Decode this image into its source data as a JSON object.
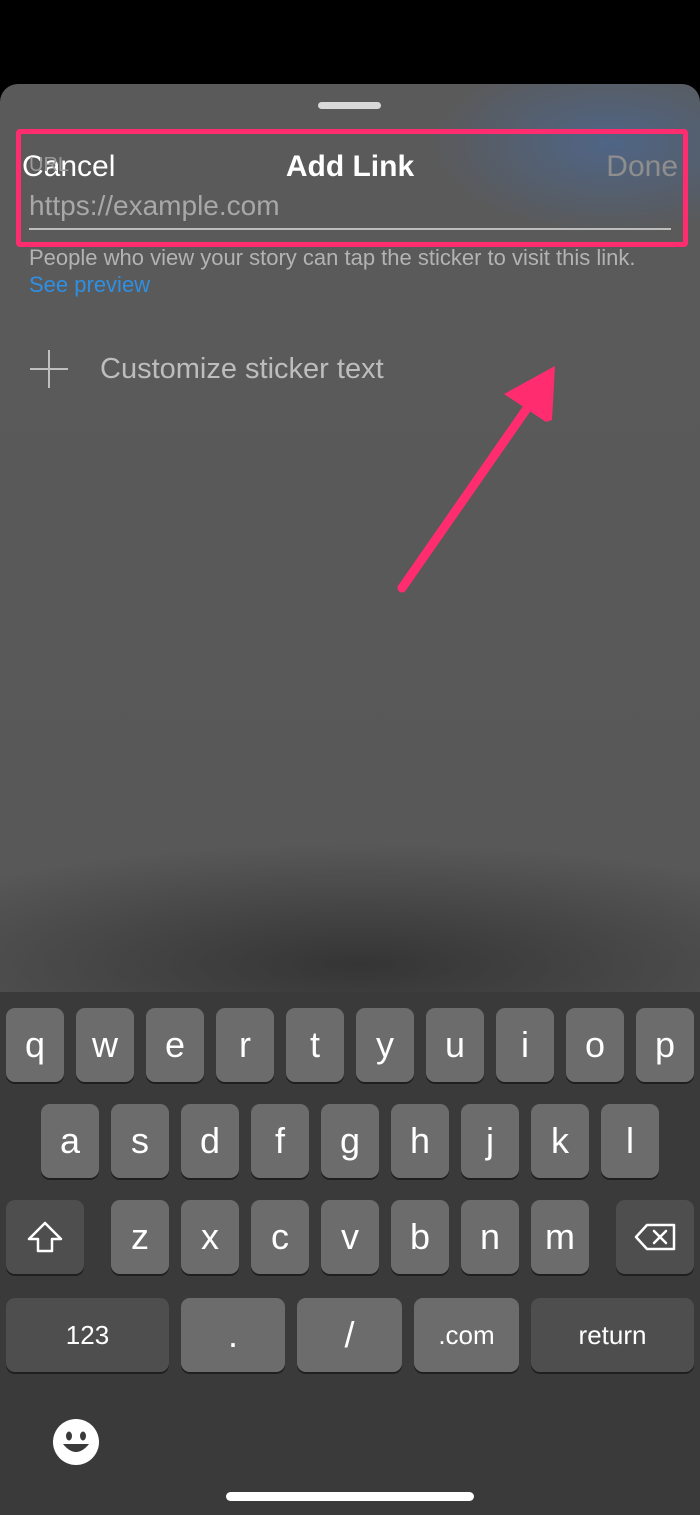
{
  "nav": {
    "cancel": "Cancel",
    "title": "Add Link",
    "done": "Done"
  },
  "url_field": {
    "label": "URL",
    "placeholder": "https://example.com",
    "value": ""
  },
  "helper": {
    "text": "People who view your story can tap the sticker to visit this link. ",
    "link": "See preview"
  },
  "customize": {
    "label": "Customize sticker text",
    "icon": "plus-icon"
  },
  "highlight_color": "#ff2d6f",
  "keyboard": {
    "row1": [
      "q",
      "w",
      "e",
      "r",
      "t",
      "y",
      "u",
      "i",
      "o",
      "p"
    ],
    "row2": [
      "a",
      "s",
      "d",
      "f",
      "g",
      "h",
      "j",
      "k",
      "l"
    ],
    "row3": [
      "z",
      "x",
      "c",
      "v",
      "b",
      "n",
      "m"
    ],
    "shift_icon": "shift-icon",
    "backspace_icon": "backspace-icon",
    "numbers": "123",
    "dot": ".",
    "slash": "/",
    "dotcom": ".com",
    "return": "return",
    "emoji_icon": "emoji-icon"
  }
}
